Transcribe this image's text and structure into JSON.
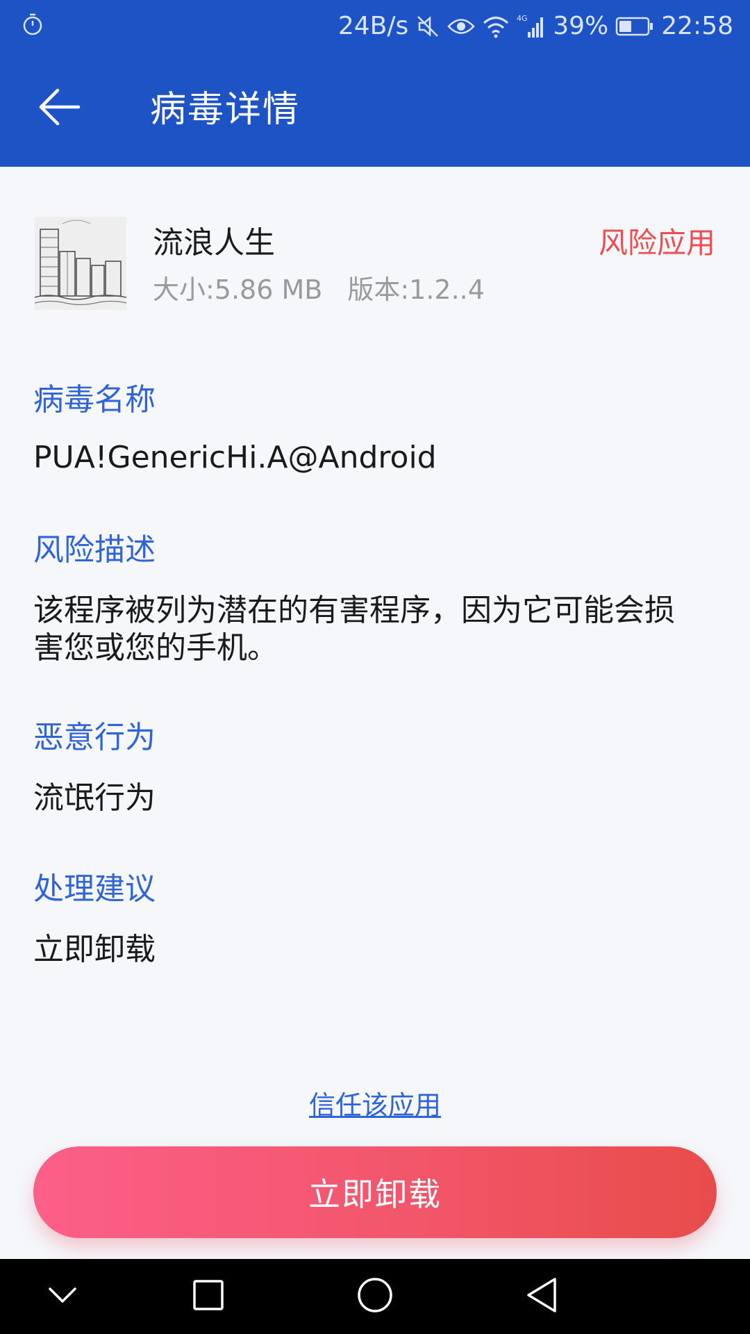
{
  "status_bar": {
    "net_speed": "24B/s",
    "battery_percent": "39%",
    "time": "22:58",
    "icons": [
      "alarm-icon",
      "mute-icon",
      "eye-icon",
      "wifi-icon",
      "signal-4g-icon",
      "battery-icon"
    ]
  },
  "app_bar": {
    "title": "病毒详情",
    "back_icon": "back-arrow-icon"
  },
  "app_info": {
    "name": "流浪人生",
    "size": "大小:5.86 MB",
    "version": "版本:1.2..4",
    "risk_label": "风险应用"
  },
  "sections": [
    {
      "label": "病毒名称",
      "value": "PUA!GenericHi.A@Android"
    },
    {
      "label": "风险描述",
      "value": "该程序被列为潜在的有害程序，因为它可能会损害您或您的手机。"
    },
    {
      "label": "恶意行为",
      "value": "流氓行为"
    },
    {
      "label": "处理建议",
      "value": "立即卸载"
    }
  ],
  "actions": {
    "trust_label": "信任该应用",
    "uninstall_label": "立即卸载"
  },
  "nav_bar": {
    "icons": [
      "chevron-down-icon",
      "square-icon",
      "circle-icon",
      "triangle-back-icon"
    ]
  },
  "colors": {
    "primary": "#1e53c6",
    "label_blue": "#2f64d8",
    "risk_red": "#ec4e52",
    "button_gradient_start": "#fc5f88",
    "button_gradient_end": "#e84c4a"
  }
}
